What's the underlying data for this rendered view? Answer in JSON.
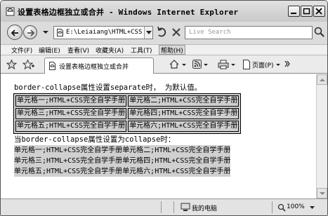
{
  "window": {
    "title_cn": "设置表格边框独立或合并",
    "title_sep": " - ",
    "title_app": "Windows Internet Explorer"
  },
  "address": {
    "value": "E:\\Leiaiang\\HTML+CSS\\"
  },
  "search": {
    "placeholder": "Live Search"
  },
  "menu": [
    {
      "label": "文件(F)"
    },
    {
      "label": "编辑(E)"
    },
    {
      "label": "查看(V)"
    },
    {
      "label": "收藏夹(A)"
    },
    {
      "label": "工具(T)"
    },
    {
      "label": "帮助(H)"
    }
  ],
  "tab": {
    "label": "设置表格边框独立或合并"
  },
  "toolbar": {
    "page_label": "页面(P)"
  },
  "content": {
    "heading_separate": "border-collapse属性设置separate时，  为默认值。",
    "table_separate": [
      [
        "单元格一;HTML+CSS完全自学手册",
        "单元格二;HTML+CSS完全自学手册"
      ],
      [
        "单元格三;HTML+CSS完全自学手册",
        "单元格四;HTML+CSS完全自学手册"
      ],
      [
        "单元格五;HTML+CSS完全自学手册",
        "单元格六;HTML+CSS完全自学手册"
      ]
    ],
    "heading_collapse": "当border-collapse属性设置为collapse时：",
    "table_collapse": [
      [
        "单元格一;HTML+CSS完全自学手册",
        "单元格二;HTML+CSS完全自学手册"
      ],
      [
        "单元格三;HTML+CSS完全自学手册",
        "单元格四;HTML+CSS完全自学手册"
      ],
      [
        "单元格五;HTML+CSS完全自学手册",
        "单元格六;HTML+CSS完全自学手册"
      ]
    ]
  },
  "status": {
    "zone": "我的电脑",
    "zoom": "100%"
  }
}
